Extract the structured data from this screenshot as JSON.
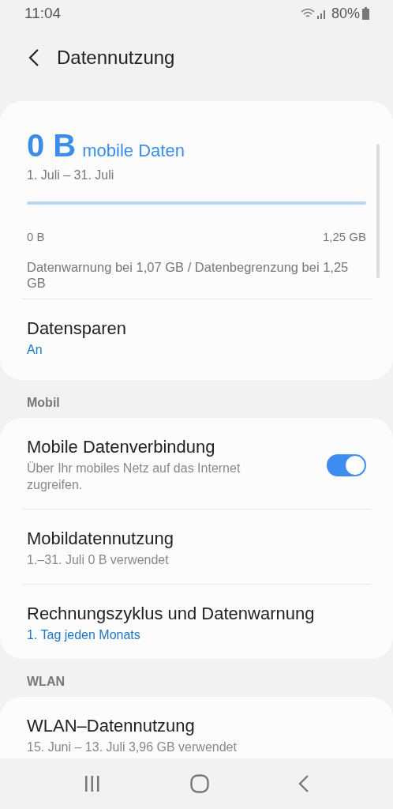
{
  "status_bar": {
    "time": "11:04",
    "battery": "80%"
  },
  "header": {
    "title": "Datennutzung"
  },
  "usage": {
    "amount": "0 B",
    "unit": "mobile Daten",
    "period": "1. Juli – 31. Juli",
    "level": 0,
    "min": "0 B",
    "max": "1,25 GB",
    "note": "Datenwarnung bei 1,07 GB / Datenbegrenzung bei 1,25 GB"
  },
  "usage_items": [
    {
      "kind": "plain",
      "title": "Datensparen",
      "subtitle": "An",
      "accent": true
    }
  ],
  "sections": [
    {
      "header": "Mobil",
      "items": [
        {
          "kind": "toggle",
          "title": "Mobile Datenverbindung",
          "subtitle": "Über Ihr mobiles Netz auf das Internet zugreifen.",
          "accent": false,
          "on": true
        },
        {
          "kind": "plain",
          "title": "Mobildatennutzung",
          "subtitle": "1.–31. Juli 0 B verwendet",
          "accent": false
        },
        {
          "kind": "plain",
          "title": "Rechnungszyklus und Datenwarnung",
          "subtitle": "1. Tag jeden Monats",
          "accent": true
        }
      ]
    },
    {
      "header": "WLAN",
      "items": [
        {
          "kind": "plain",
          "title": "WLAN–Datennutzung",
          "subtitle": "15. Juni – 13. Juli 3,96 GB verwendet",
          "accent": false
        }
      ]
    }
  ]
}
